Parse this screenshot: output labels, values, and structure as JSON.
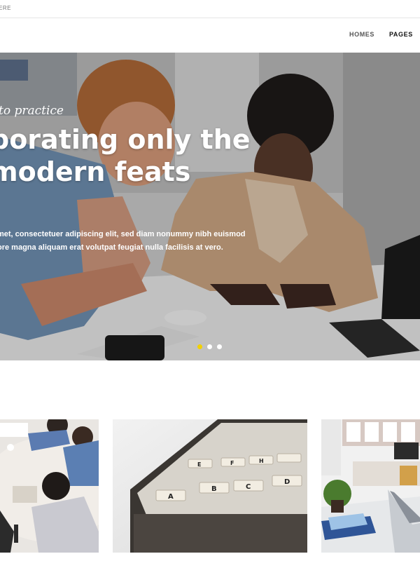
{
  "topbar": {
    "text": "ERE"
  },
  "nav": {
    "items": [
      {
        "label": "HOMES"
      },
      {
        "label": "PAGES"
      }
    ]
  },
  "hero": {
    "eyebrow": "to practice",
    "title_line1": "porating only the",
    "title_line2": "modern feats",
    "text_line1": "met, consectetuer adipiscing elit, sed diam nonummy nibh euismod",
    "text_line2": "ore magna aliquam erat volutpat feugiat nulla facilisis at vero.",
    "slides_count": 3,
    "active_slide": 1,
    "accent_color": "#f2d100"
  },
  "file_tabs": {
    "a": "A",
    "b": "B",
    "c": "C",
    "d": "D",
    "e": "E",
    "f": "F",
    "h": "H"
  }
}
